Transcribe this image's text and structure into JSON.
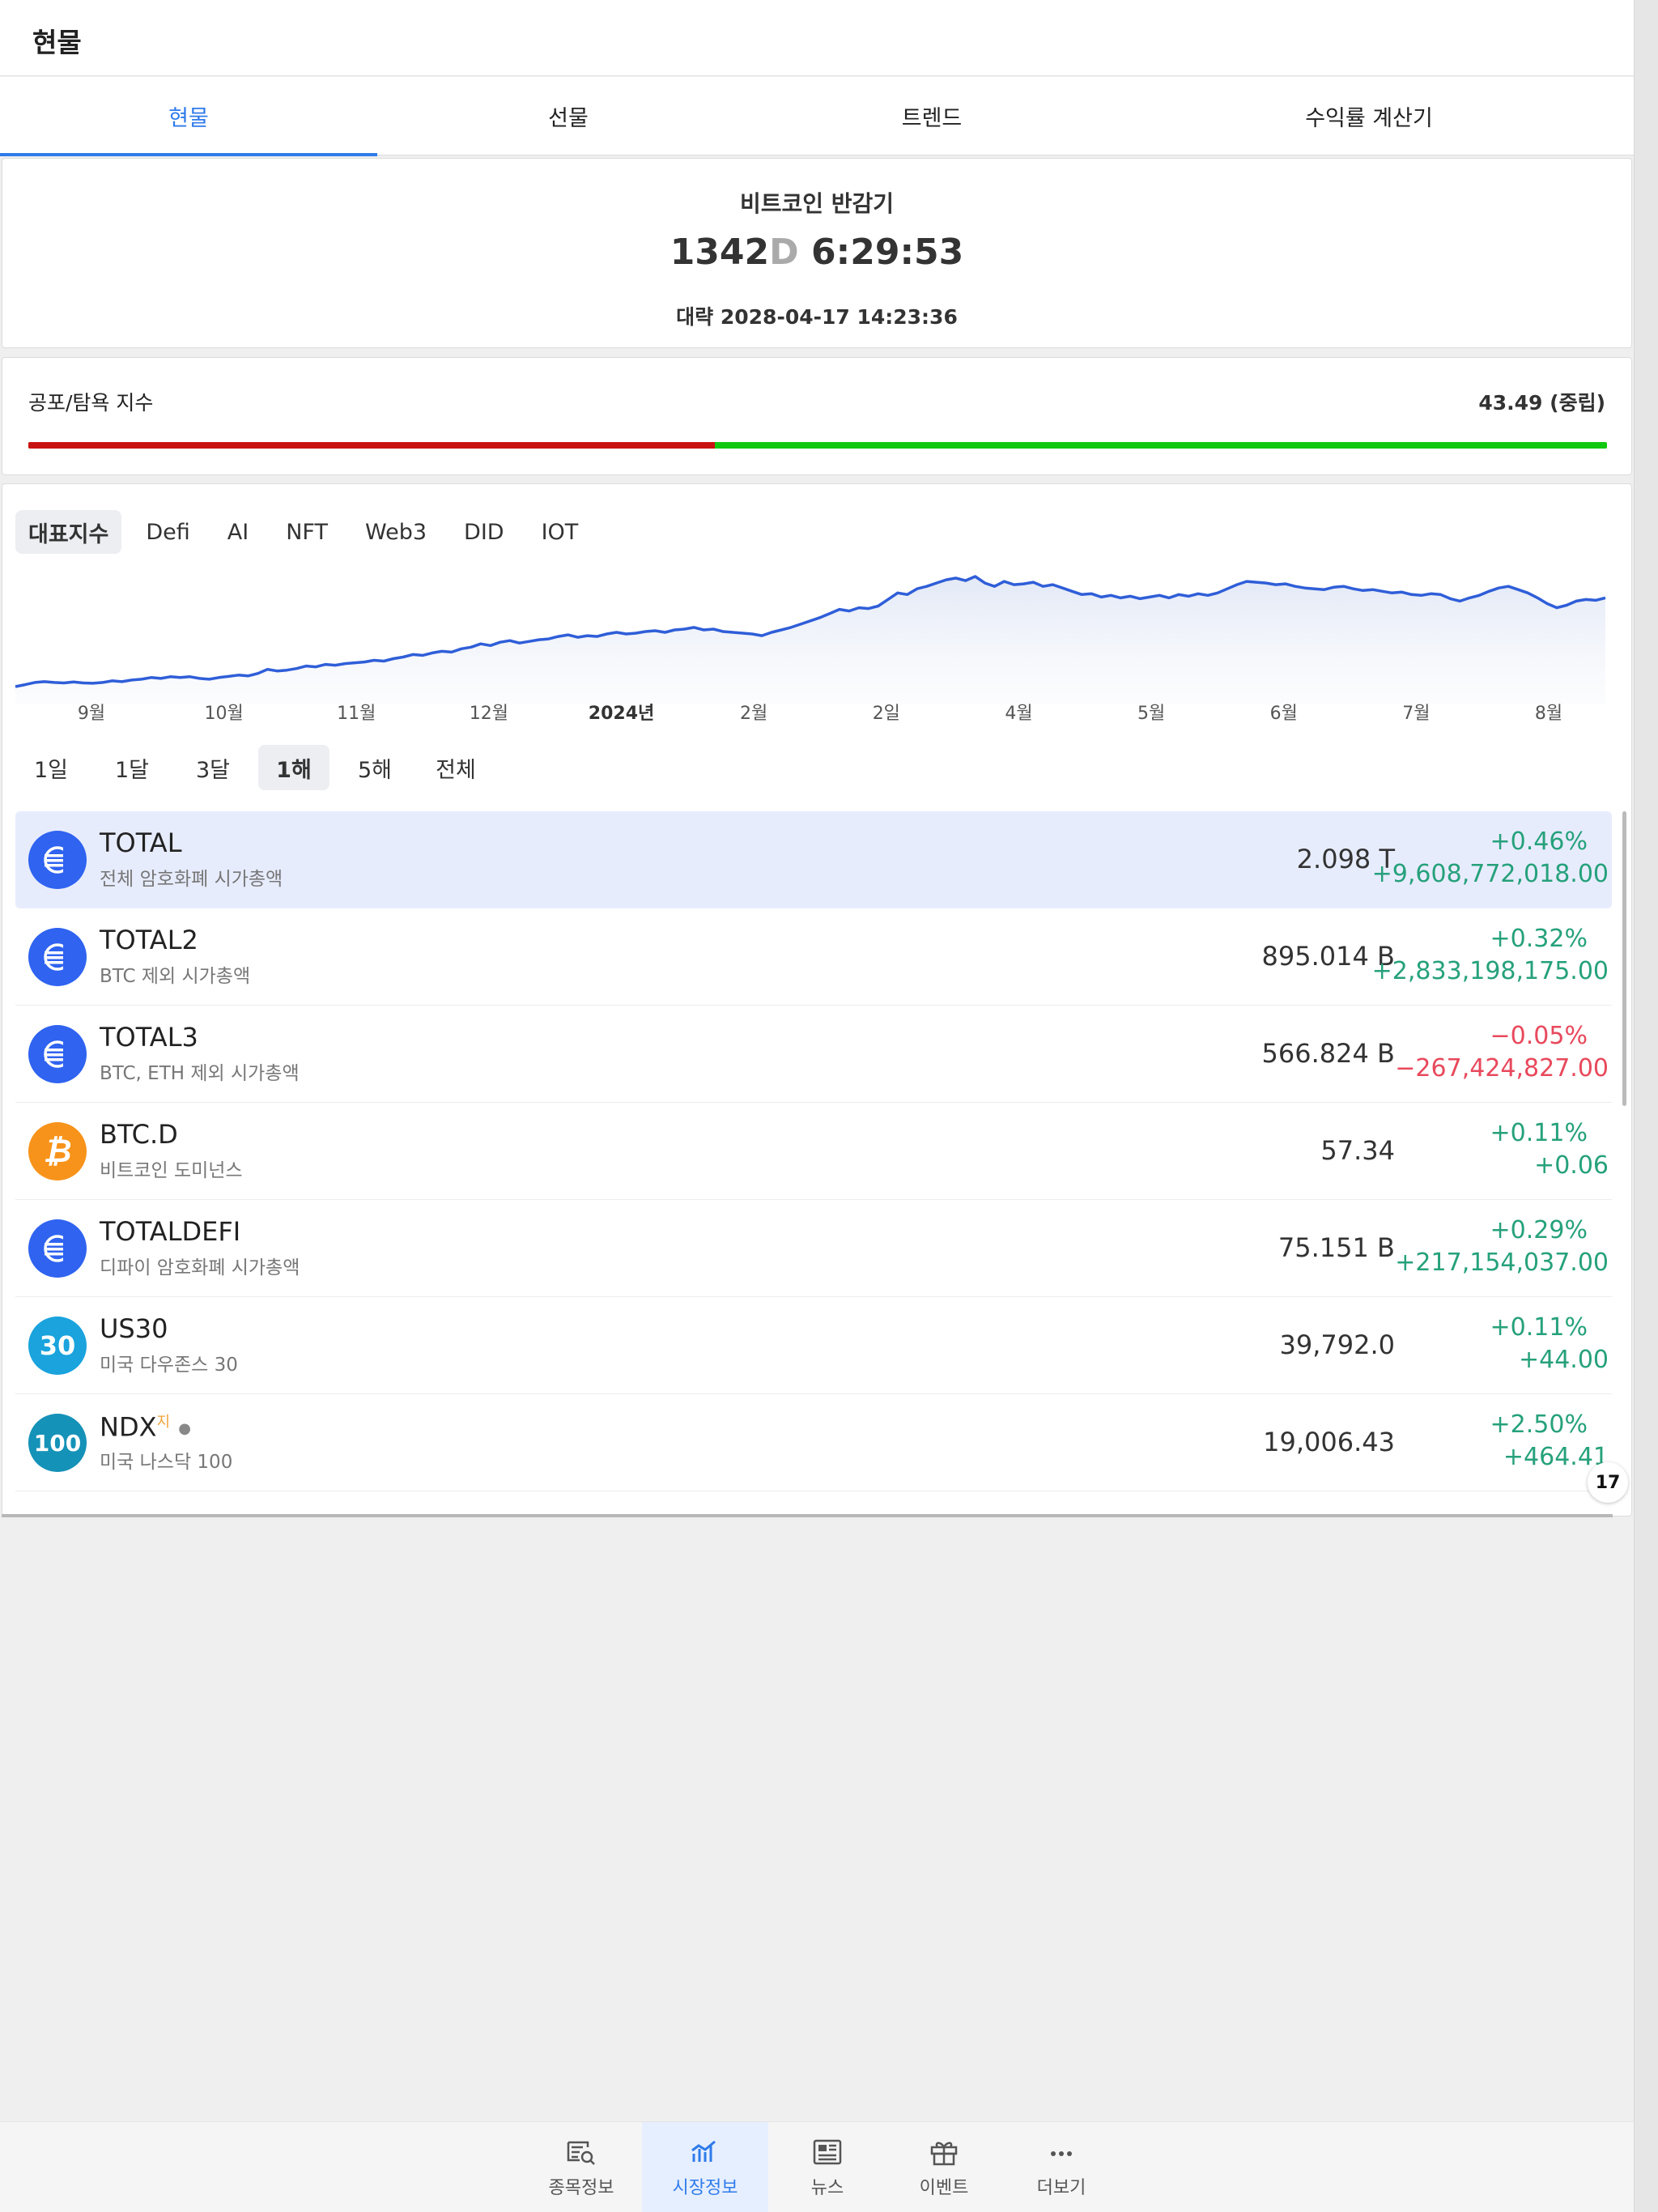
{
  "header": {
    "title": "현물"
  },
  "tabs": [
    {
      "label": "현물",
      "active": true
    },
    {
      "label": "선물",
      "active": false
    },
    {
      "label": "트렌드",
      "active": false
    },
    {
      "label": "수익률 계산기",
      "active": false
    }
  ],
  "halving": {
    "title": "비트코인 반감기",
    "days": "1342",
    "day_unit": "D",
    "time": "6:29:53",
    "date": "대략 2028-04-17 14:23:36"
  },
  "fear_greed": {
    "label": "공포/탐욕 지수",
    "value_text": "43.49 (중립)",
    "value": 43.49
  },
  "categories": [
    {
      "label": "대표지수",
      "active": true
    },
    {
      "label": "Defi",
      "active": false
    },
    {
      "label": "AI",
      "active": false
    },
    {
      "label": "NFT",
      "active": false
    },
    {
      "label": "Web3",
      "active": false
    },
    {
      "label": "DID",
      "active": false
    },
    {
      "label": "IOT",
      "active": false
    }
  ],
  "chart_data": {
    "type": "area",
    "x_tick_labels": [
      "9월",
      "10월",
      "11월",
      "12월",
      "2024년",
      "2월",
      "2일",
      "4월",
      "5월",
      "6월",
      "7월",
      "8월"
    ],
    "line_color": "#2f5ed8",
    "values": [
      0.5,
      0.62,
      0.75,
      0.8,
      0.75,
      0.72,
      0.78,
      0.72,
      0.7,
      0.75,
      0.85,
      0.8,
      0.9,
      0.95,
      1.05,
      1.0,
      1.1,
      1.05,
      1.1,
      1.0,
      0.95,
      1.05,
      1.12,
      1.2,
      1.15,
      1.3,
      1.55,
      1.45,
      1.5,
      1.6,
      1.75,
      1.7,
      1.85,
      1.8,
      1.9,
      1.95,
      2.0,
      2.1,
      2.05,
      2.2,
      2.3,
      2.45,
      2.4,
      2.55,
      2.65,
      2.6,
      2.8,
      2.9,
      3.1,
      3.0,
      3.2,
      3.3,
      3.15,
      3.25,
      3.35,
      3.4,
      3.55,
      3.65,
      3.5,
      3.6,
      3.55,
      3.7,
      3.8,
      3.7,
      3.75,
      3.85,
      3.9,
      3.8,
      3.95,
      4.0,
      4.1,
      3.95,
      4.0,
      3.85,
      3.8,
      3.75,
      3.7,
      3.6,
      3.8,
      3.95,
      4.1,
      4.3,
      4.5,
      4.7,
      4.95,
      5.2,
      5.1,
      5.3,
      5.25,
      5.4,
      5.8,
      6.2,
      6.1,
      6.45,
      6.6,
      6.8,
      7.0,
      7.1,
      6.95,
      7.2,
      6.8,
      6.6,
      6.9,
      6.7,
      6.75,
      6.85,
      6.6,
      6.7,
      6.5,
      6.3,
      6.1,
      6.15,
      5.95,
      6.05,
      5.9,
      6.0,
      5.85,
      5.95,
      6.05,
      5.9,
      6.1,
      6.0,
      6.15,
      6.05,
      6.2,
      6.45,
      6.7,
      6.9,
      6.85,
      6.8,
      6.7,
      6.75,
      6.6,
      6.5,
      6.45,
      6.4,
      6.55,
      6.6,
      6.45,
      6.35,
      6.4,
      6.3,
      6.2,
      6.25,
      6.1,
      6.05,
      6.15,
      6.1,
      5.85,
      5.7,
      5.9,
      6.05,
      6.3,
      6.5,
      6.6,
      6.4,
      6.2,
      5.9,
      5.55,
      5.3,
      5.45,
      5.7,
      5.8,
      5.75,
      5.9
    ]
  },
  "ranges": [
    {
      "label": "1일",
      "active": false
    },
    {
      "label": "1달",
      "active": false
    },
    {
      "label": "3달",
      "active": false
    },
    {
      "label": "1해",
      "active": true
    },
    {
      "label": "5해",
      "active": false
    },
    {
      "label": "전체",
      "active": false
    }
  ],
  "rows": [
    {
      "symbol": "TOTAL",
      "desc": "전체 암호화폐 시가총액",
      "price": "2.098 T",
      "pct": "+0.46%",
      "chg": "+9,608,772,018.00",
      "dir": "up",
      "icon": "total-index-icon",
      "logo_color": "#2f63f0",
      "selected": true
    },
    {
      "symbol": "TOTAL2",
      "desc": "BTC 제외 시가총액",
      "price": "895.014 B",
      "pct": "+0.32%",
      "chg": "+2,833,198,175.00",
      "dir": "up",
      "icon": "total-index-icon",
      "logo_color": "#2f63f0",
      "selected": false
    },
    {
      "symbol": "TOTAL3",
      "desc": "BTC, ETH 제외 시가총액",
      "price": "566.824 B",
      "pct": "−0.05%",
      "chg": "−267,424,827.00",
      "dir": "down",
      "icon": "total-index-icon",
      "logo_color": "#2f63f0",
      "selected": false
    },
    {
      "symbol": "BTC.D",
      "desc": "비트코인 도미넌스",
      "price": "57.34",
      "pct": "+0.11%",
      "chg": "+0.06",
      "dir": "up",
      "icon": "bitcoin-icon",
      "logo_color": "#f7931a",
      "selected": false
    },
    {
      "symbol": "TOTALDEFI",
      "desc": "디파이 암호화폐 시가총액",
      "price": "75.151 B",
      "pct": "+0.29%",
      "chg": "+217,154,037.00",
      "dir": "up",
      "icon": "total-index-icon",
      "logo_color": "#2f63f0",
      "selected": false
    },
    {
      "symbol": "US30",
      "desc": "미국 다우존스 30",
      "price": "39,792.0",
      "pct": "+0.11%",
      "chg": "+44.00",
      "dir": "up",
      "icon": "us30-icon",
      "logo_color": "#1aa3dd",
      "logo_text": "30",
      "selected": false
    },
    {
      "symbol": "NDX",
      "symbol_sup": "지",
      "desc": "미국 나스닥 100",
      "price": "19,006.43",
      "pct": "+2.50%",
      "chg": "+464.41",
      "dir": "up",
      "icon": "ndx-icon",
      "logo_color": "#1592b8",
      "logo_text": "100",
      "selected": false
    }
  ],
  "tradingview_badge": "17",
  "bottom_nav": [
    {
      "label": "종목정보",
      "icon": "symbol-search-icon",
      "active": false
    },
    {
      "label": "시장정보",
      "icon": "market-chart-icon",
      "active": true
    },
    {
      "label": "뉴스",
      "icon": "news-icon",
      "active": false
    },
    {
      "label": "이벤트",
      "icon": "gift-icon",
      "active": false
    },
    {
      "label": "더보기",
      "icon": "more-dots-icon",
      "active": false
    }
  ]
}
